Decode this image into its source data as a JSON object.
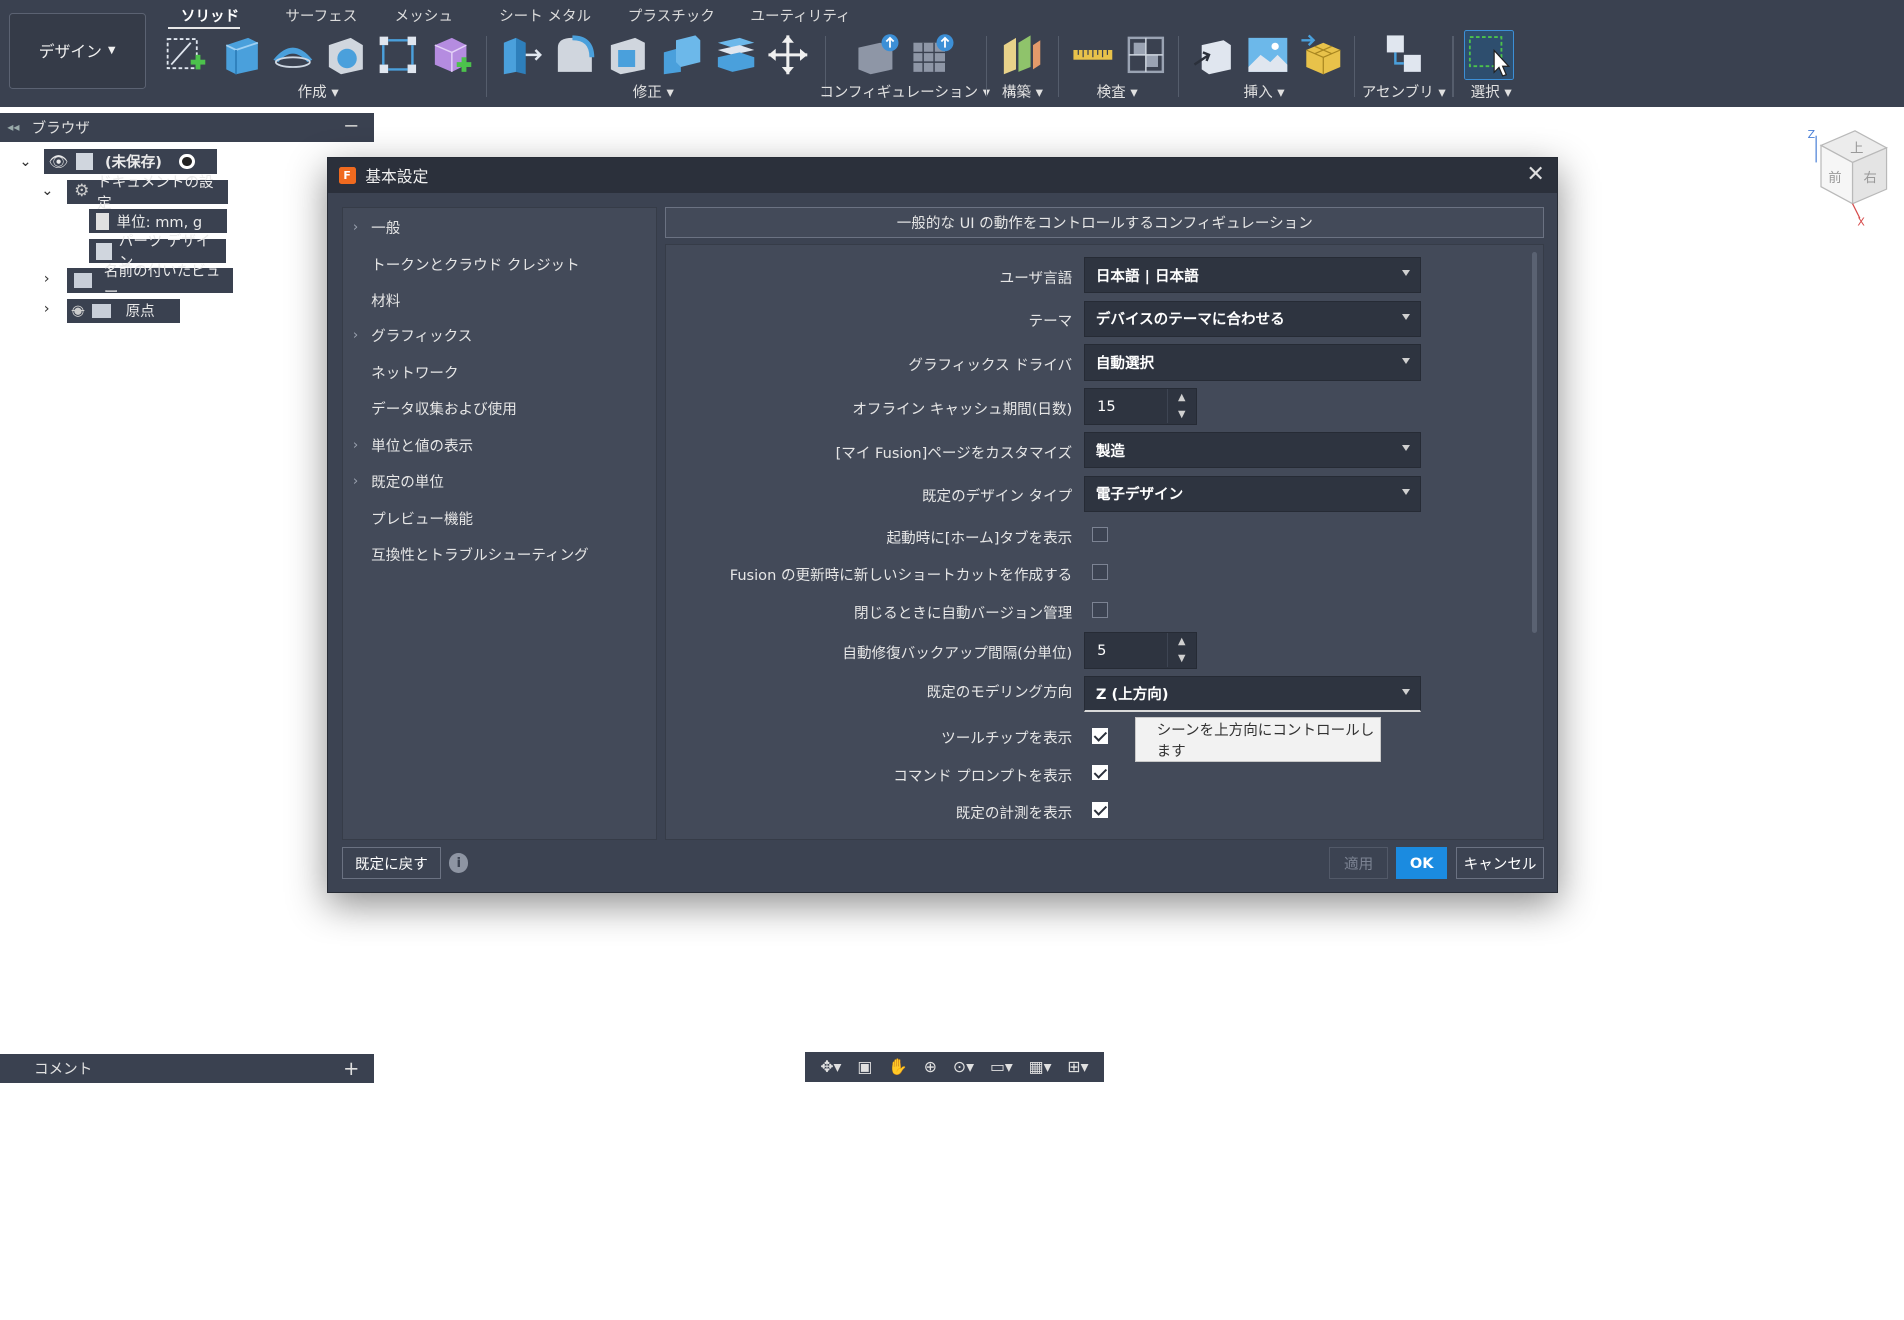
{
  "toolbar": {
    "workspace": "デザイン",
    "tabs": [
      "ソリッド",
      "サーフェス",
      "メッシュ",
      "シート メタル",
      "プラスチック",
      "ユーティリティ"
    ],
    "groups": [
      "作成",
      "修正",
      "コンフィギュレーション",
      "構築",
      "検査",
      "挿入",
      "アセンブリ",
      "選択"
    ]
  },
  "browser": {
    "title": "ブラウザ",
    "root": "(未保存)",
    "doc_settings": "ドキュメントの設定",
    "units": "単位: mm, g",
    "part_design": "パーツ デザイン",
    "named_views": "名前の付いたビュー",
    "origin": "原点"
  },
  "comment": {
    "label": "コメント"
  },
  "viewcube": {
    "top": "上",
    "front": "前",
    "right": "右",
    "z": "Z",
    "x": "X"
  },
  "dialog": {
    "title": "基本設定",
    "header": "一般的な UI の動作をコントロールするコンフィギュレーション",
    "nav": [
      {
        "label": "一般",
        "expandable": true
      },
      {
        "label": "トークンとクラウド クレジット",
        "expandable": false
      },
      {
        "label": "材料",
        "expandable": false
      },
      {
        "label": "グラフィックス",
        "expandable": true
      },
      {
        "label": "ネットワーク",
        "expandable": false
      },
      {
        "label": "データ収集および使用",
        "expandable": false
      },
      {
        "label": "単位と値の表示",
        "expandable": true
      },
      {
        "label": "既定の単位",
        "expandable": true
      },
      {
        "label": "プレビュー機能",
        "expandable": false
      },
      {
        "label": "互換性とトラブルシューティング",
        "expandable": false
      }
    ],
    "settings": {
      "language": {
        "label": "ユーザ言語",
        "value": "日本語 | 日本語"
      },
      "theme": {
        "label": "テーマ",
        "value": "デバイスのテーマに合わせる"
      },
      "graphics_driver": {
        "label": "グラフィックス ドライバ",
        "value": "自動選択"
      },
      "offline_cache": {
        "label": "オフライン キャッシュ期間(日数)",
        "value": "15"
      },
      "my_fusion": {
        "label": "[マイ Fusion]ページをカスタマイズ",
        "value": "製造"
      },
      "design_type": {
        "label": "既定のデザイン タイプ",
        "value": "電子デザイン"
      },
      "show_home": {
        "label": "起動時に[ホーム]タブを表示",
        "checked": false
      },
      "shortcut": {
        "label": "Fusion の更新時に新しいショートカットを作成する",
        "checked": false
      },
      "auto_version": {
        "label": "閉じるときに自動バージョン管理",
        "checked": false
      },
      "backup_interval": {
        "label": "自動修復バックアップ間隔(分単位)",
        "value": "5"
      },
      "modeling_dir": {
        "label": "既定のモデリング方向",
        "value": "Z (上方向)"
      },
      "tooltips": {
        "label": "ツールチップを表示",
        "checked": true
      },
      "command_prompt": {
        "label": "コマンド プロンプトを表示",
        "checked": true
      },
      "measure": {
        "label": "既定の計測を表示",
        "checked": true
      }
    },
    "tooltip": "シーンを上方向にコントロールします",
    "buttons": {
      "reset": "既定に戻す",
      "apply": "適用",
      "ok": "OK",
      "cancel": "キャンセル"
    }
  }
}
